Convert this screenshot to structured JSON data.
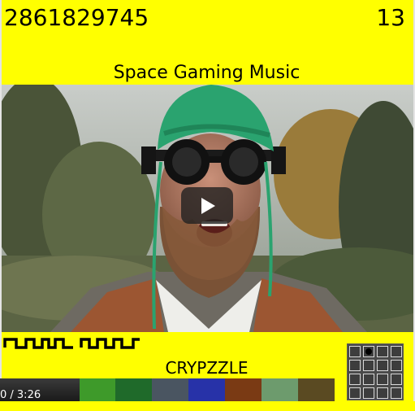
{
  "header": {
    "left_number": "2861829745",
    "right_number": "13"
  },
  "title": "Space Gaming Music",
  "video": {
    "time": "0 / 3:26"
  },
  "bottom_label": "CRYPZZLE",
  "colors": {
    "background": "#ffff00",
    "palette": [
      "#3e9a2a",
      "#1f6a2a",
      "#4a5561",
      "#2732a8",
      "#7a3a14",
      "#6d9b6d",
      "#5a4a22"
    ]
  },
  "icons": {
    "play": "play-icon",
    "grid": "grid-icon",
    "logo": "wave-logo-icon"
  }
}
